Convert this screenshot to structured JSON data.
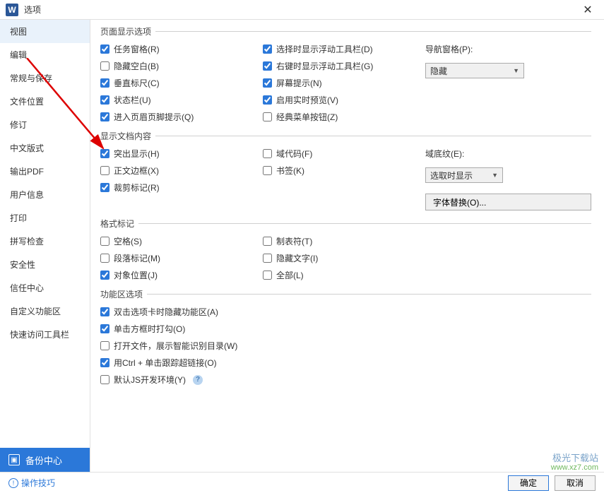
{
  "titlebar": {
    "title": "选项"
  },
  "sidebar": {
    "items": [
      "视图",
      "编辑",
      "常规与保存",
      "文件位置",
      "修订",
      "中文版式",
      "输出PDF",
      "用户信息",
      "打印",
      "拼写检查",
      "安全性",
      "信任中心",
      "自定义功能区",
      "快速访问工具栏"
    ],
    "active_index": 0,
    "backup_label": "备份中心"
  },
  "sections": {
    "page_display": {
      "legend": "页面显示选项",
      "col1": [
        {
          "label": "任务窗格(R)",
          "checked": true
        },
        {
          "label": "隐藏空白(B)",
          "checked": false
        },
        {
          "label": "垂直标尺(C)",
          "checked": true
        },
        {
          "label": "状态栏(U)",
          "checked": true
        },
        {
          "label": "进入页眉页脚提示(Q)",
          "checked": true
        }
      ],
      "col2": [
        {
          "label": "选择时显示浮动工具栏(D)",
          "checked": true
        },
        {
          "label": "右键时显示浮动工具栏(G)",
          "checked": true
        },
        {
          "label": "屏幕提示(N)",
          "checked": true
        },
        {
          "label": "启用实时预览(V)",
          "checked": true
        },
        {
          "label": "经典菜单按钮(Z)",
          "checked": false
        }
      ],
      "nav_label": "导航窗格(P):",
      "nav_value": "隐藏"
    },
    "doc_content": {
      "legend": "显示文档内容",
      "col1": [
        {
          "label": "突出显示(H)",
          "checked": true
        },
        {
          "label": "正文边框(X)",
          "checked": false
        },
        {
          "label": "裁剪标记(R)",
          "checked": true
        }
      ],
      "col2": [
        {
          "label": "域代码(F)",
          "checked": false
        },
        {
          "label": "书签(K)",
          "checked": false
        }
      ],
      "shade_label": "域底纹(E):",
      "shade_value": "选取时显示",
      "font_sub_btn": "字体替换(O)..."
    },
    "format_marks": {
      "legend": "格式标记",
      "col1": [
        {
          "label": "空格(S)",
          "checked": false
        },
        {
          "label": "段落标记(M)",
          "checked": false
        },
        {
          "label": "对象位置(J)",
          "checked": true
        }
      ],
      "col2": [
        {
          "label": "制表符(T)",
          "checked": false
        },
        {
          "label": "隐藏文字(I)",
          "checked": false
        },
        {
          "label": "全部(L)",
          "checked": false
        }
      ]
    },
    "ribbon": {
      "legend": "功能区选项",
      "items": [
        {
          "label": "双击选项卡时隐藏功能区(A)",
          "checked": true
        },
        {
          "label": "单击方框时打勾(O)",
          "checked": true
        },
        {
          "label": "打开文件，展示智能识别目录(W)",
          "checked": false
        },
        {
          "label": "用Ctrl + 单击跟踪超链接(O)",
          "checked": true
        },
        {
          "label": "默认JS开发环境(Y)",
          "checked": false,
          "help": true
        }
      ]
    }
  },
  "footer": {
    "tips": "操作技巧",
    "ok": "确定",
    "cancel": "取消"
  },
  "watermark": {
    "l1": "极光下载站",
    "l2": "www.xz7.com"
  }
}
